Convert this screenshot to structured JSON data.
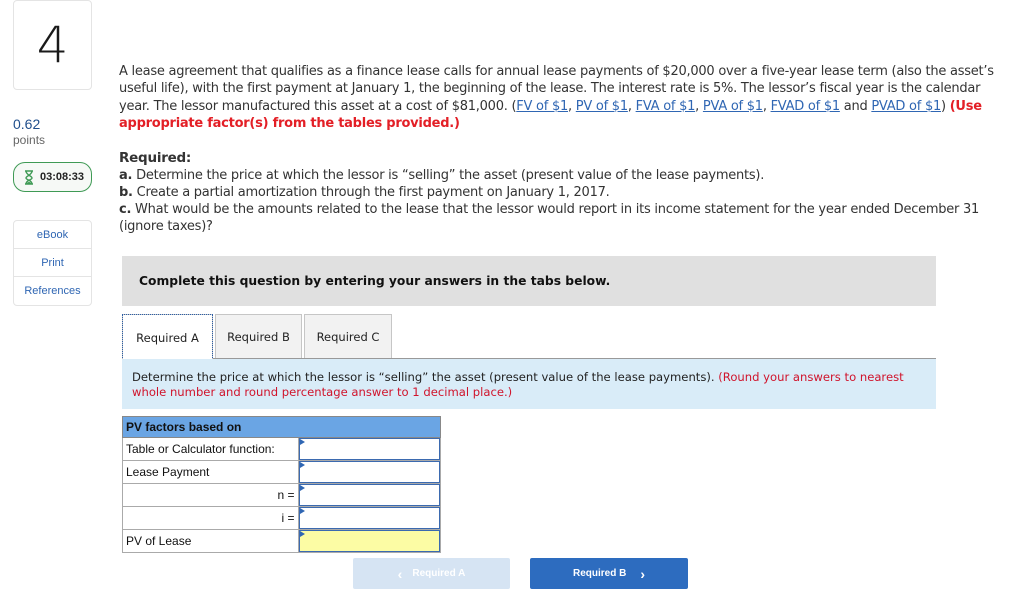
{
  "sidebar": {
    "question_number": "4",
    "points_value": "0.62",
    "points_label": "points",
    "timer": "03:08:33",
    "tools": [
      {
        "label": "eBook"
      },
      {
        "label": "Print"
      },
      {
        "label": "References"
      }
    ]
  },
  "question": {
    "text_part1": "A lease agreement that qualifies as a finance lease calls for annual lease payments of $20,000 over a five-year lease term (also the asset’s useful life), with the first payment at January 1, the beginning of the lease. The interest rate is 5%. The lessor’s fiscal year is the calendar year. The lessor manufactured this asset at a cost of $81,000. (",
    "links": [
      {
        "label": "FV of $1"
      },
      {
        "label": "PV of $1"
      },
      {
        "label": "FVA of $1"
      },
      {
        "label": "PVA of $1"
      },
      {
        "label": "FVAD of $1"
      },
      {
        "label": "PVAD of $1"
      }
    ],
    "sep_comma": ", ",
    "sep_and": " and ",
    "close_paren": ") ",
    "instruction_red": "(Use appropriate factor(s) from the tables provided.)"
  },
  "required": {
    "heading": "Required:",
    "items": [
      {
        "letter": "a.",
        "text": " Determine the price at which the lessor is “selling” the asset (present value of the lease payments)."
      },
      {
        "letter": "b.",
        "text": " Create a partial amortization through the first payment on January 1, 2017."
      },
      {
        "letter": "c.",
        "text": " What would be the amounts related to the lease that the lessor would report in its income statement for the year ended December 31 (ignore taxes)?"
      }
    ]
  },
  "banner": "Complete this question by entering your answers in the tabs below.",
  "tabs": [
    {
      "label": "Required A",
      "active": true
    },
    {
      "label": "Required B",
      "active": false
    },
    {
      "label": "Required C",
      "active": false
    }
  ],
  "instructions": {
    "text": "Determine the price at which the lessor is “selling” the asset (present value of the lease payments). ",
    "red": "(Round your answers to nearest whole number and round percentage answer to 1 decimal place.)"
  },
  "pv_table": {
    "header": "PV factors based on",
    "rows": [
      {
        "label": "Table or Calculator function:",
        "align": "left",
        "value": ""
      },
      {
        "label": "Lease Payment",
        "align": "left",
        "value": ""
      },
      {
        "label": "n =",
        "align": "right",
        "value": ""
      },
      {
        "label": "i =",
        "align": "right",
        "value": ""
      },
      {
        "label": "PV of Lease",
        "align": "left",
        "value": "",
        "highlight": "#fcfca4"
      }
    ]
  },
  "nav": {
    "prev_label": "Required A",
    "next_label": "Required B"
  },
  "colors": {
    "accent_blue": "#2d6cbf",
    "link_blue": "#2f66b3",
    "instruction_red": "#e31f26",
    "timer_green": "#3f9a55",
    "table_header_blue": "#6aa5e4",
    "answer_yellow": "#fcfca4"
  }
}
